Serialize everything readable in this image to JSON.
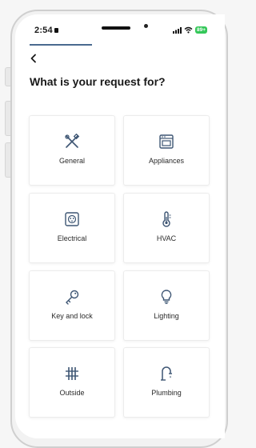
{
  "status_bar": {
    "time": "2:54",
    "battery": "89+"
  },
  "header": {
    "back_icon": "chevron-left-icon",
    "title": "What is your request for?"
  },
  "categories": [
    {
      "label": "General",
      "icon": "tools-icon"
    },
    {
      "label": "Appliances",
      "icon": "oven-icon"
    },
    {
      "label": "Electrical",
      "icon": "outlet-icon"
    },
    {
      "label": "HVAC",
      "icon": "thermometer-icon"
    },
    {
      "label": "Key and lock",
      "icon": "key-icon"
    },
    {
      "label": "Lighting",
      "icon": "lightbulb-icon"
    },
    {
      "label": "Outside",
      "icon": "fence-icon"
    },
    {
      "label": "Plumbing",
      "icon": "faucet-icon"
    }
  ],
  "colors": {
    "icon_stroke": "#3d5573",
    "accent_underline": "#4a6a8f",
    "battery": "#34c759"
  }
}
